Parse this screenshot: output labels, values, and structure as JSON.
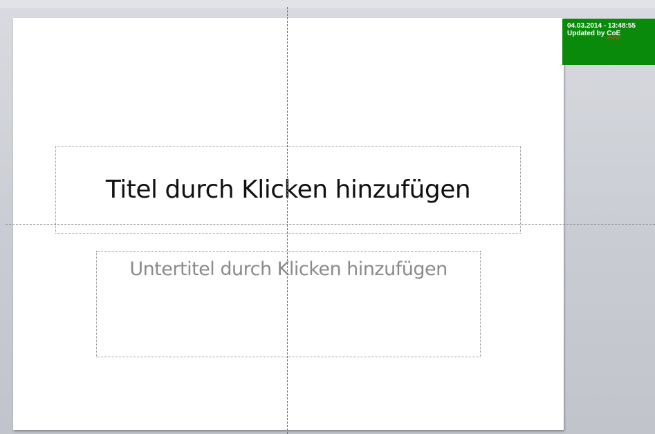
{
  "slide": {
    "title_placeholder": "Titel durch Klicken hinzufügen",
    "subtitle_placeholder": "Untertitel durch Klicken hinzufügen"
  },
  "status_badge": {
    "timestamp": "04.03.2014 - 13:48:55",
    "updated_prefix": "Updated by ",
    "updated_by": "CoE",
    "color": "#0a8a0a"
  },
  "colors": {
    "title_text": "#111111",
    "subtitle_text": "#8a8a8a",
    "workspace_bg": "#c9ccd2"
  }
}
